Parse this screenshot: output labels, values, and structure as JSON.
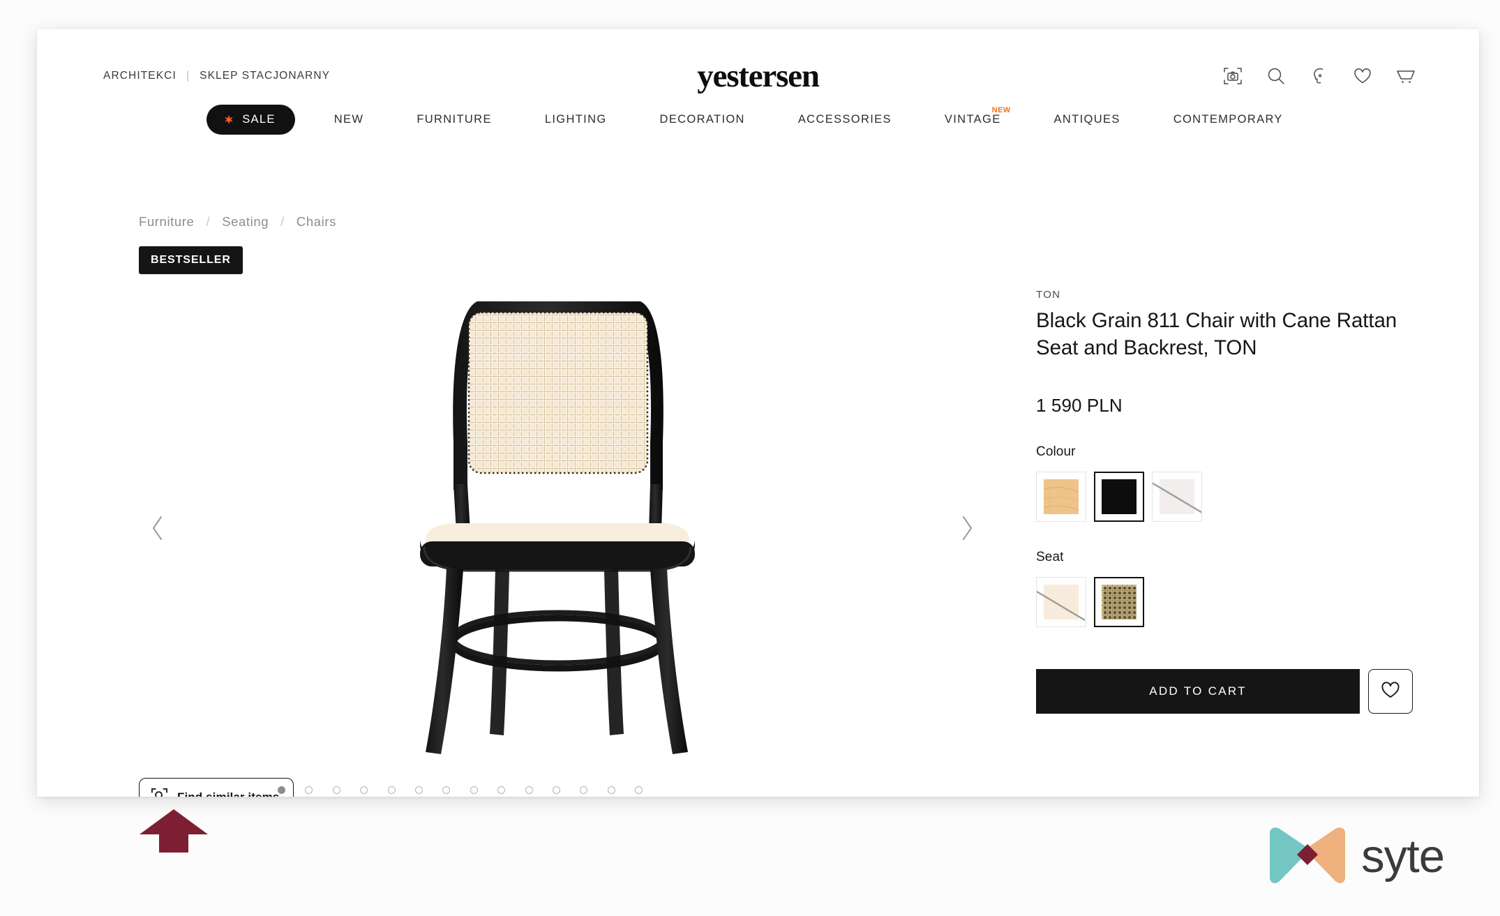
{
  "header": {
    "utility_links": [
      {
        "label": "ARCHITEKCI",
        "name": "utility-link-architekci"
      },
      {
        "label": "SKLEP STACJONARNY",
        "name": "utility-link-sklep-stacjonarny"
      }
    ],
    "separator": "|",
    "brand": "yestersen",
    "icons": [
      {
        "name": "visual-search-camera-icon",
        "label": "visual-search"
      },
      {
        "name": "search-icon",
        "label": "search"
      },
      {
        "name": "account-head-icon",
        "label": "account"
      },
      {
        "name": "wishlist-heart-icon",
        "label": "wishlist"
      },
      {
        "name": "cart-icon",
        "label": "cart"
      }
    ]
  },
  "nav": {
    "sale": {
      "label": "SALE",
      "icon": "star-icon",
      "bg": "#111111",
      "star_color": "#f2582a"
    },
    "items": [
      {
        "label": "NEW",
        "badge": ""
      },
      {
        "label": "FURNITURE",
        "badge": ""
      },
      {
        "label": "LIGHTING",
        "badge": ""
      },
      {
        "label": "DECORATION",
        "badge": ""
      },
      {
        "label": "ACCESSORIES",
        "badge": ""
      },
      {
        "label": "VINTAGE",
        "badge": "NEW"
      },
      {
        "label": "ANTIQUES",
        "badge": ""
      },
      {
        "label": "CONTEMPORARY",
        "badge": ""
      }
    ],
    "badge_color": "#f2711c"
  },
  "breadcrumb": {
    "items": [
      "Furniture",
      "Seating",
      "Chairs"
    ],
    "separator": "/"
  },
  "badge": {
    "bestseller": "BESTSELLER"
  },
  "gallery": {
    "prev_label": "‹",
    "next_label": "›",
    "dot_count": 14,
    "active_dot": 1,
    "find_similar": {
      "label": "Find similar items",
      "icon": "framed-search-icon"
    }
  },
  "product": {
    "brand": "TON",
    "title": "Black Grain 811 Chair with Cane Rattan Seat and Backrest, TON",
    "price": "1 590 PLN",
    "options": [
      {
        "label": "Colour",
        "name": "colour",
        "swatches": [
          {
            "name": "swatch-natural-wood",
            "color": "#efc48a",
            "kind": "wood",
            "selected": false,
            "unavailable": false
          },
          {
            "name": "swatch-black",
            "color": "#0d0d0d",
            "kind": "solid",
            "selected": true,
            "unavailable": false
          },
          {
            "name": "swatch-white",
            "color": "#f1eeed",
            "kind": "solid",
            "selected": false,
            "unavailable": true
          }
        ]
      },
      {
        "label": "Seat",
        "name": "seat",
        "swatches": [
          {
            "name": "swatch-cream-plywood",
            "color": "#f7ecdc",
            "kind": "solid",
            "selected": false,
            "unavailable": true
          },
          {
            "name": "swatch-cane-rattan",
            "color": "#cbb887",
            "kind": "rattan",
            "selected": true,
            "unavailable": false
          }
        ]
      }
    ],
    "add_to_cart": "ADD TO CART",
    "wishlist_icon": "heart-icon"
  },
  "overlay": {
    "arrow": {
      "name": "annotation-arrow",
      "color": "#7d1f33"
    },
    "syte": {
      "wordmark": "syte",
      "teal": "#74c6c2",
      "orange": "#eeb07c",
      "accent": "#7d1f33"
    }
  }
}
